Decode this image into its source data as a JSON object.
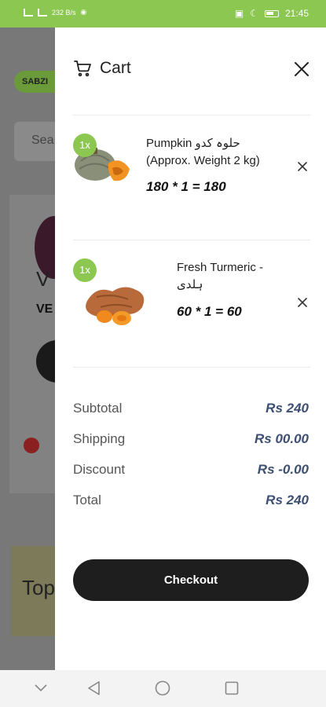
{
  "status_bar": {
    "network": "232 B/s",
    "time": "21:45"
  },
  "background": {
    "badge": "SABZI",
    "search_placeholder": "Sea",
    "product_letter": "V",
    "product_label": "VE",
    "banner_text": "Top"
  },
  "cart": {
    "title": "Cart",
    "items": [
      {
        "qty": "1x",
        "name_line1": "Pumpkin حلوہ کدو",
        "name_line2": "(Approx. Weight 2 kg)",
        "calc_prefix": "180 * ",
        "calc_qty": "1",
        "calc_suffix": " = 180",
        "image": "pumpkin"
      },
      {
        "qty": "1x",
        "name_line1": "Fresh Turmeric -",
        "name_line2": "ہلدی",
        "calc_prefix": "60 * ",
        "calc_qty": "1",
        "calc_suffix": " = 60",
        "image": "turmeric"
      }
    ],
    "summary": {
      "subtotal_label": "Subtotal",
      "subtotal_value": "Rs 240",
      "shipping_label": "Shipping",
      "shipping_value": "Rs 00.00",
      "discount_label": "Discount",
      "discount_value": "Rs -0.00",
      "total_label": "Total",
      "total_value": "Rs 240"
    },
    "checkout_label": "Checkout"
  },
  "colors": {
    "accent": "#8cc751",
    "price": "#3d4f72",
    "button": "#1e1e1e"
  }
}
